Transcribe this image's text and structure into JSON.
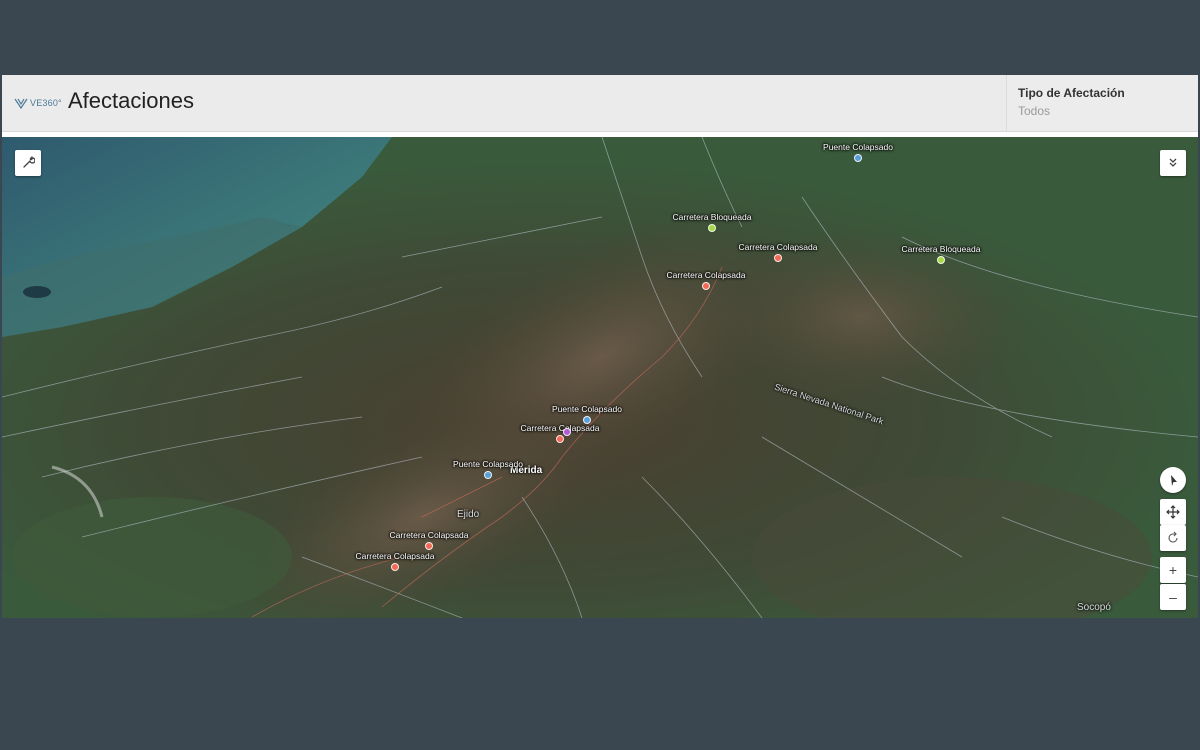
{
  "header": {
    "logo_text": "VE360°",
    "title": "Afectaciones"
  },
  "filter": {
    "label": "Tipo de Afectación",
    "value": "Todos"
  },
  "colors": {
    "puente_colapsado": "#5aa0d6",
    "carretera_bloqueada": "#a6d84a",
    "carretera_colapsada": "#f06a55",
    "other": "#b05bd4"
  },
  "map": {
    "places": {
      "merida": "Mérida",
      "ejido": "Ejido",
      "park": "Sierra Nevada National Park",
      "socopo": "Socopó"
    },
    "markers": [
      {
        "label": "Puente Colapsado",
        "type": "puente_colapsado"
      },
      {
        "label": "Carretera Bloqueada",
        "type": "carretera_bloqueada"
      },
      {
        "label": "Carretera Colapsada",
        "type": "carretera_colapsada"
      },
      {
        "label": "Carretera Bloqueada",
        "type": "carretera_bloqueada"
      },
      {
        "label": "Carretera Colapsada",
        "type": "carretera_colapsada"
      },
      {
        "label": "Puente Colapsado",
        "type": "puente_colapsado"
      },
      {
        "label": "Carretera Colapsada",
        "type": "carretera_colapsada"
      },
      {
        "label": "",
        "type": "other"
      },
      {
        "label": "Puente Colapsado",
        "type": "puente_colapsado"
      },
      {
        "label": "Carretera Colapsada",
        "type": "carretera_colapsada"
      },
      {
        "label": "Carretera Colapsada",
        "type": "carretera_colapsada"
      }
    ]
  },
  "controls": {
    "tool_icon": "wrench-icon",
    "collapse_icon": "double-chevron-down-icon",
    "compass_icon": "compass-icon",
    "pan_icon": "pan-arrows-icon",
    "rotate_icon": "rotate-icon",
    "zoom_in_label": "+",
    "zoom_out_label": "–"
  }
}
